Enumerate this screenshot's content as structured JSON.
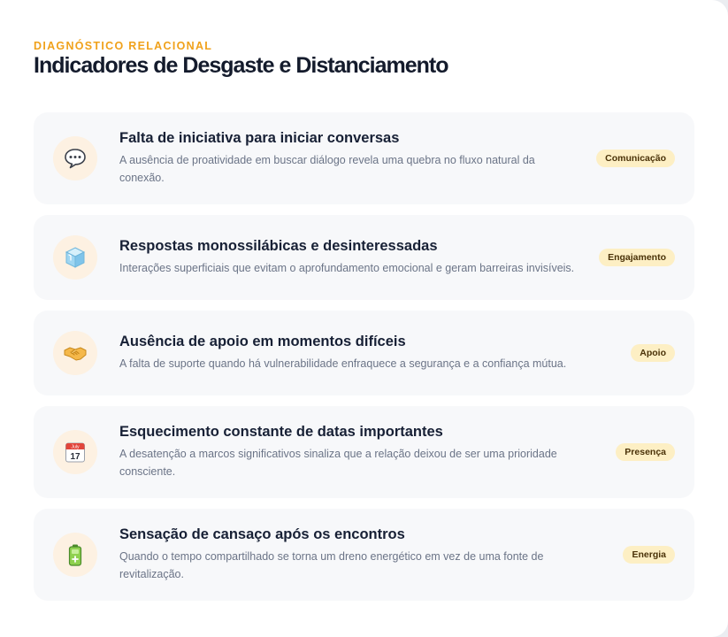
{
  "header": {
    "eyebrow": "DIAGNÓSTICO RELACIONAL",
    "title": "Indicadores de Desgaste e Distanciamento"
  },
  "items": [
    {
      "icon": "speech-balloon-icon",
      "title": "Falta de iniciativa para iniciar conversas",
      "description": "A ausência de proatividade em buscar diálogo revela uma quebra no fluxo natural da conexão.",
      "badge": "Comunicação"
    },
    {
      "icon": "ice-cube-icon",
      "title": "Respostas monossilábicas e desinteressadas",
      "description": "Interações superficiais que evitam o aprofundamento emocional e geram barreiras invisíveis.",
      "badge": "Engajamento"
    },
    {
      "icon": "handshake-icon",
      "title": "Ausência de apoio em momentos difíceis",
      "description": "A falta de suporte quando há vulnerabilidade enfraquece a segurança e a confiança mútua.",
      "badge": "Apoio"
    },
    {
      "icon": "calendar-icon",
      "calendar_month": "July",
      "calendar_day": "17",
      "title": "Esquecimento constante de datas importantes",
      "description": "A desatenção a marcos significativos sinaliza que a relação deixou de ser uma prioridade consciente.",
      "badge": "Presença"
    },
    {
      "icon": "low-battery-icon",
      "title": "Sensação de cansaço após os encontros",
      "description": "Quando o tempo compartilhado se torna um dreno energético em vez de uma fonte de revitalização.",
      "badge": "Energia"
    }
  ],
  "colors": {
    "accent": "#f0a11b",
    "badge_bg": "#fdefc4",
    "icon_bg": "#fdf1e2",
    "card_bg": "#f7f8fa"
  }
}
